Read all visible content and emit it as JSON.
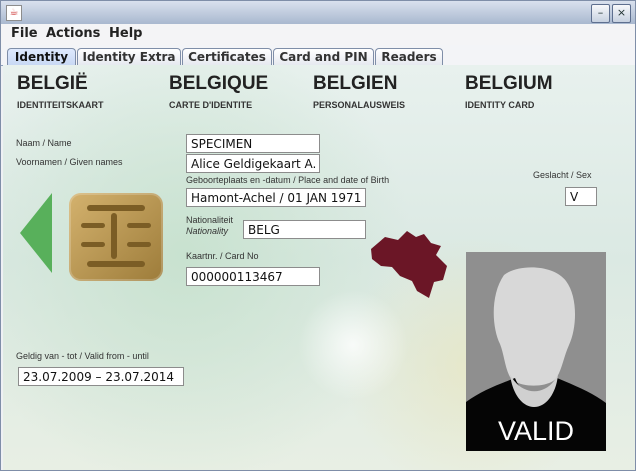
{
  "window": {
    "app_icon": "java-icon",
    "minimize": "–",
    "close": "×"
  },
  "menu": [
    "File",
    "Actions",
    "Help"
  ],
  "tabs": [
    "Identity",
    "Identity Extra",
    "Certificates",
    "Card and PIN",
    "Readers"
  ],
  "header": {
    "countries": [
      "BELGIË",
      "BELGIQUE",
      "BELGIEN",
      "BELGIUM"
    ],
    "types": [
      "IDENTITEITSKAART",
      "CARTE D'IDENTITE",
      "PERSONALAUSWEIS",
      "IDENTITY CARD"
    ]
  },
  "identity": {
    "name_label": "Naam / Name",
    "name_value": "SPECIMEN",
    "given_label": "Voornamen / Given names",
    "given_value": "Alice Geldigekaart A.",
    "birth_label": "Geboorteplaats en -datum / Place and date of Birth",
    "birth_value": "Hamont-Achel / 01 JAN 1971",
    "sex_label": "Geslacht / Sex",
    "sex_value": "V",
    "nationality_label_1": "Nationaliteit",
    "nationality_label_2": "Nationality",
    "nationality_value": "BELG",
    "card_label": "Kaartnr. / Card No",
    "card_value": "000000113467",
    "valid_label": "Geldig van - tot / Valid from - until",
    "valid_value": "23.07.2009 – 23.07.2014",
    "photo_text": "VALID"
  }
}
